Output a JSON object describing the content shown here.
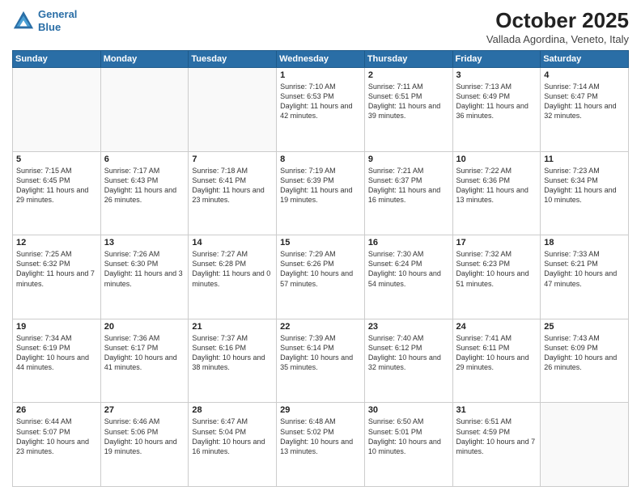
{
  "header": {
    "logo_line1": "General",
    "logo_line2": "Blue",
    "title": "October 2025",
    "location": "Vallada Agordina, Veneto, Italy"
  },
  "weekdays": [
    "Sunday",
    "Monday",
    "Tuesday",
    "Wednesday",
    "Thursday",
    "Friday",
    "Saturday"
  ],
  "weeks": [
    [
      {
        "day": "",
        "info": ""
      },
      {
        "day": "",
        "info": ""
      },
      {
        "day": "",
        "info": ""
      },
      {
        "day": "1",
        "info": "Sunrise: 7:10 AM\nSunset: 6:53 PM\nDaylight: 11 hours and 42 minutes."
      },
      {
        "day": "2",
        "info": "Sunrise: 7:11 AM\nSunset: 6:51 PM\nDaylight: 11 hours and 39 minutes."
      },
      {
        "day": "3",
        "info": "Sunrise: 7:13 AM\nSunset: 6:49 PM\nDaylight: 11 hours and 36 minutes."
      },
      {
        "day": "4",
        "info": "Sunrise: 7:14 AM\nSunset: 6:47 PM\nDaylight: 11 hours and 32 minutes."
      }
    ],
    [
      {
        "day": "5",
        "info": "Sunrise: 7:15 AM\nSunset: 6:45 PM\nDaylight: 11 hours and 29 minutes."
      },
      {
        "day": "6",
        "info": "Sunrise: 7:17 AM\nSunset: 6:43 PM\nDaylight: 11 hours and 26 minutes."
      },
      {
        "day": "7",
        "info": "Sunrise: 7:18 AM\nSunset: 6:41 PM\nDaylight: 11 hours and 23 minutes."
      },
      {
        "day": "8",
        "info": "Sunrise: 7:19 AM\nSunset: 6:39 PM\nDaylight: 11 hours and 19 minutes."
      },
      {
        "day": "9",
        "info": "Sunrise: 7:21 AM\nSunset: 6:37 PM\nDaylight: 11 hours and 16 minutes."
      },
      {
        "day": "10",
        "info": "Sunrise: 7:22 AM\nSunset: 6:36 PM\nDaylight: 11 hours and 13 minutes."
      },
      {
        "day": "11",
        "info": "Sunrise: 7:23 AM\nSunset: 6:34 PM\nDaylight: 11 hours and 10 minutes."
      }
    ],
    [
      {
        "day": "12",
        "info": "Sunrise: 7:25 AM\nSunset: 6:32 PM\nDaylight: 11 hours and 7 minutes."
      },
      {
        "day": "13",
        "info": "Sunrise: 7:26 AM\nSunset: 6:30 PM\nDaylight: 11 hours and 3 minutes."
      },
      {
        "day": "14",
        "info": "Sunrise: 7:27 AM\nSunset: 6:28 PM\nDaylight: 11 hours and 0 minutes."
      },
      {
        "day": "15",
        "info": "Sunrise: 7:29 AM\nSunset: 6:26 PM\nDaylight: 10 hours and 57 minutes."
      },
      {
        "day": "16",
        "info": "Sunrise: 7:30 AM\nSunset: 6:24 PM\nDaylight: 10 hours and 54 minutes."
      },
      {
        "day": "17",
        "info": "Sunrise: 7:32 AM\nSunset: 6:23 PM\nDaylight: 10 hours and 51 minutes."
      },
      {
        "day": "18",
        "info": "Sunrise: 7:33 AM\nSunset: 6:21 PM\nDaylight: 10 hours and 47 minutes."
      }
    ],
    [
      {
        "day": "19",
        "info": "Sunrise: 7:34 AM\nSunset: 6:19 PM\nDaylight: 10 hours and 44 minutes."
      },
      {
        "day": "20",
        "info": "Sunrise: 7:36 AM\nSunset: 6:17 PM\nDaylight: 10 hours and 41 minutes."
      },
      {
        "day": "21",
        "info": "Sunrise: 7:37 AM\nSunset: 6:16 PM\nDaylight: 10 hours and 38 minutes."
      },
      {
        "day": "22",
        "info": "Sunrise: 7:39 AM\nSunset: 6:14 PM\nDaylight: 10 hours and 35 minutes."
      },
      {
        "day": "23",
        "info": "Sunrise: 7:40 AM\nSunset: 6:12 PM\nDaylight: 10 hours and 32 minutes."
      },
      {
        "day": "24",
        "info": "Sunrise: 7:41 AM\nSunset: 6:11 PM\nDaylight: 10 hours and 29 minutes."
      },
      {
        "day": "25",
        "info": "Sunrise: 7:43 AM\nSunset: 6:09 PM\nDaylight: 10 hours and 26 minutes."
      }
    ],
    [
      {
        "day": "26",
        "info": "Sunrise: 6:44 AM\nSunset: 5:07 PM\nDaylight: 10 hours and 23 minutes."
      },
      {
        "day": "27",
        "info": "Sunrise: 6:46 AM\nSunset: 5:06 PM\nDaylight: 10 hours and 19 minutes."
      },
      {
        "day": "28",
        "info": "Sunrise: 6:47 AM\nSunset: 5:04 PM\nDaylight: 10 hours and 16 minutes."
      },
      {
        "day": "29",
        "info": "Sunrise: 6:48 AM\nSunset: 5:02 PM\nDaylight: 10 hours and 13 minutes."
      },
      {
        "day": "30",
        "info": "Sunrise: 6:50 AM\nSunset: 5:01 PM\nDaylight: 10 hours and 10 minutes."
      },
      {
        "day": "31",
        "info": "Sunrise: 6:51 AM\nSunset: 4:59 PM\nDaylight: 10 hours and 7 minutes."
      },
      {
        "day": "",
        "info": ""
      }
    ]
  ]
}
